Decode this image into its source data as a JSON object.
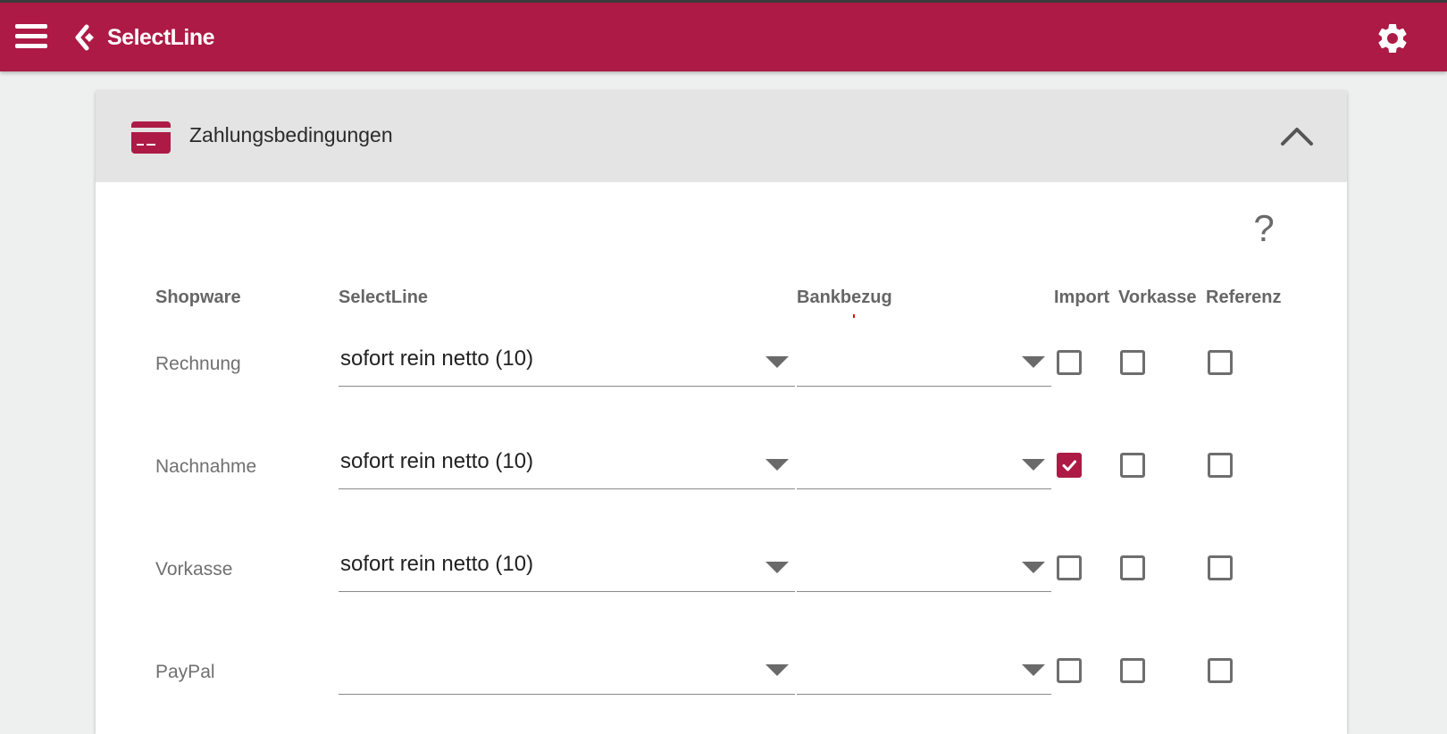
{
  "app": {
    "brand": "SelectLine",
    "brand_color": "#ad1a46"
  },
  "icons": {
    "menu": "hamburger-menu-icon",
    "logo": "selectline-logo-icon",
    "settings": "gear-icon",
    "section": "credit-card-icon",
    "collapse": "chevron-up-icon",
    "help": "question-mark-icon",
    "dropdown": "caret-down-icon",
    "check": "checkmark-icon"
  },
  "section": {
    "title": "Zahlungsbedingungen",
    "help_label": "?"
  },
  "table": {
    "columns": {
      "shopware": "Shopware",
      "selectline": "SelectLine",
      "bankbezug": "Bankbezug",
      "import": "Import",
      "vorkasse": "Vorkasse",
      "referenz": "Referenz"
    },
    "rows": [
      {
        "shopware": "Rechnung",
        "selectline": "sofort rein netto (10)",
        "bankbezug": "",
        "import": false,
        "vorkasse": false,
        "referenz": false
      },
      {
        "shopware": "Nachnahme",
        "selectline": "sofort rein netto (10)",
        "bankbezug": "",
        "import": true,
        "vorkasse": false,
        "referenz": false
      },
      {
        "shopware": "Vorkasse",
        "selectline": "sofort rein netto (10)",
        "bankbezug": "",
        "import": false,
        "vorkasse": false,
        "referenz": false
      },
      {
        "shopware": "PayPal",
        "selectline": "",
        "bankbezug": "",
        "import": false,
        "vorkasse": false,
        "referenz": false
      }
    ]
  }
}
